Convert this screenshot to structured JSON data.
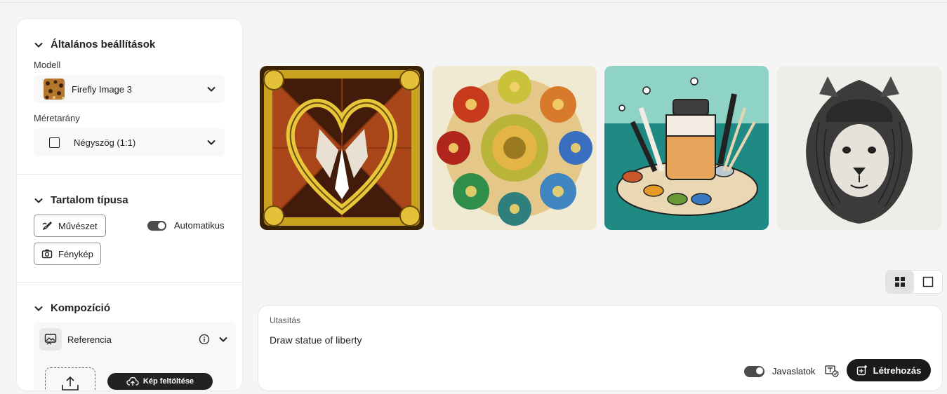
{
  "general": {
    "title": "Általános beállítások",
    "model_label": "Modell",
    "model_value": "Firefly Image 3",
    "aspect_label": "Méretarány",
    "aspect_value": "Négyszög (1:1)"
  },
  "content_type": {
    "title": "Tartalom típusa",
    "art_label": "Művészet",
    "photo_label": "Fénykép",
    "auto_label": "Automatikus",
    "auto_on": true
  },
  "composition": {
    "title": "Kompozíció",
    "reference_label": "Referencia",
    "upload_label": "Kép feltöltése"
  },
  "prompt": {
    "label": "Utasítás",
    "text": "Draw statue of liberty",
    "suggestions_label": "Javaslatok",
    "suggestions_on": true,
    "generate_label": "Létrehozás"
  },
  "colors": {
    "accent_dark": "#1b1b1b",
    "panel_bg": "#ffffff",
    "page_bg": "#f5f5f5"
  }
}
